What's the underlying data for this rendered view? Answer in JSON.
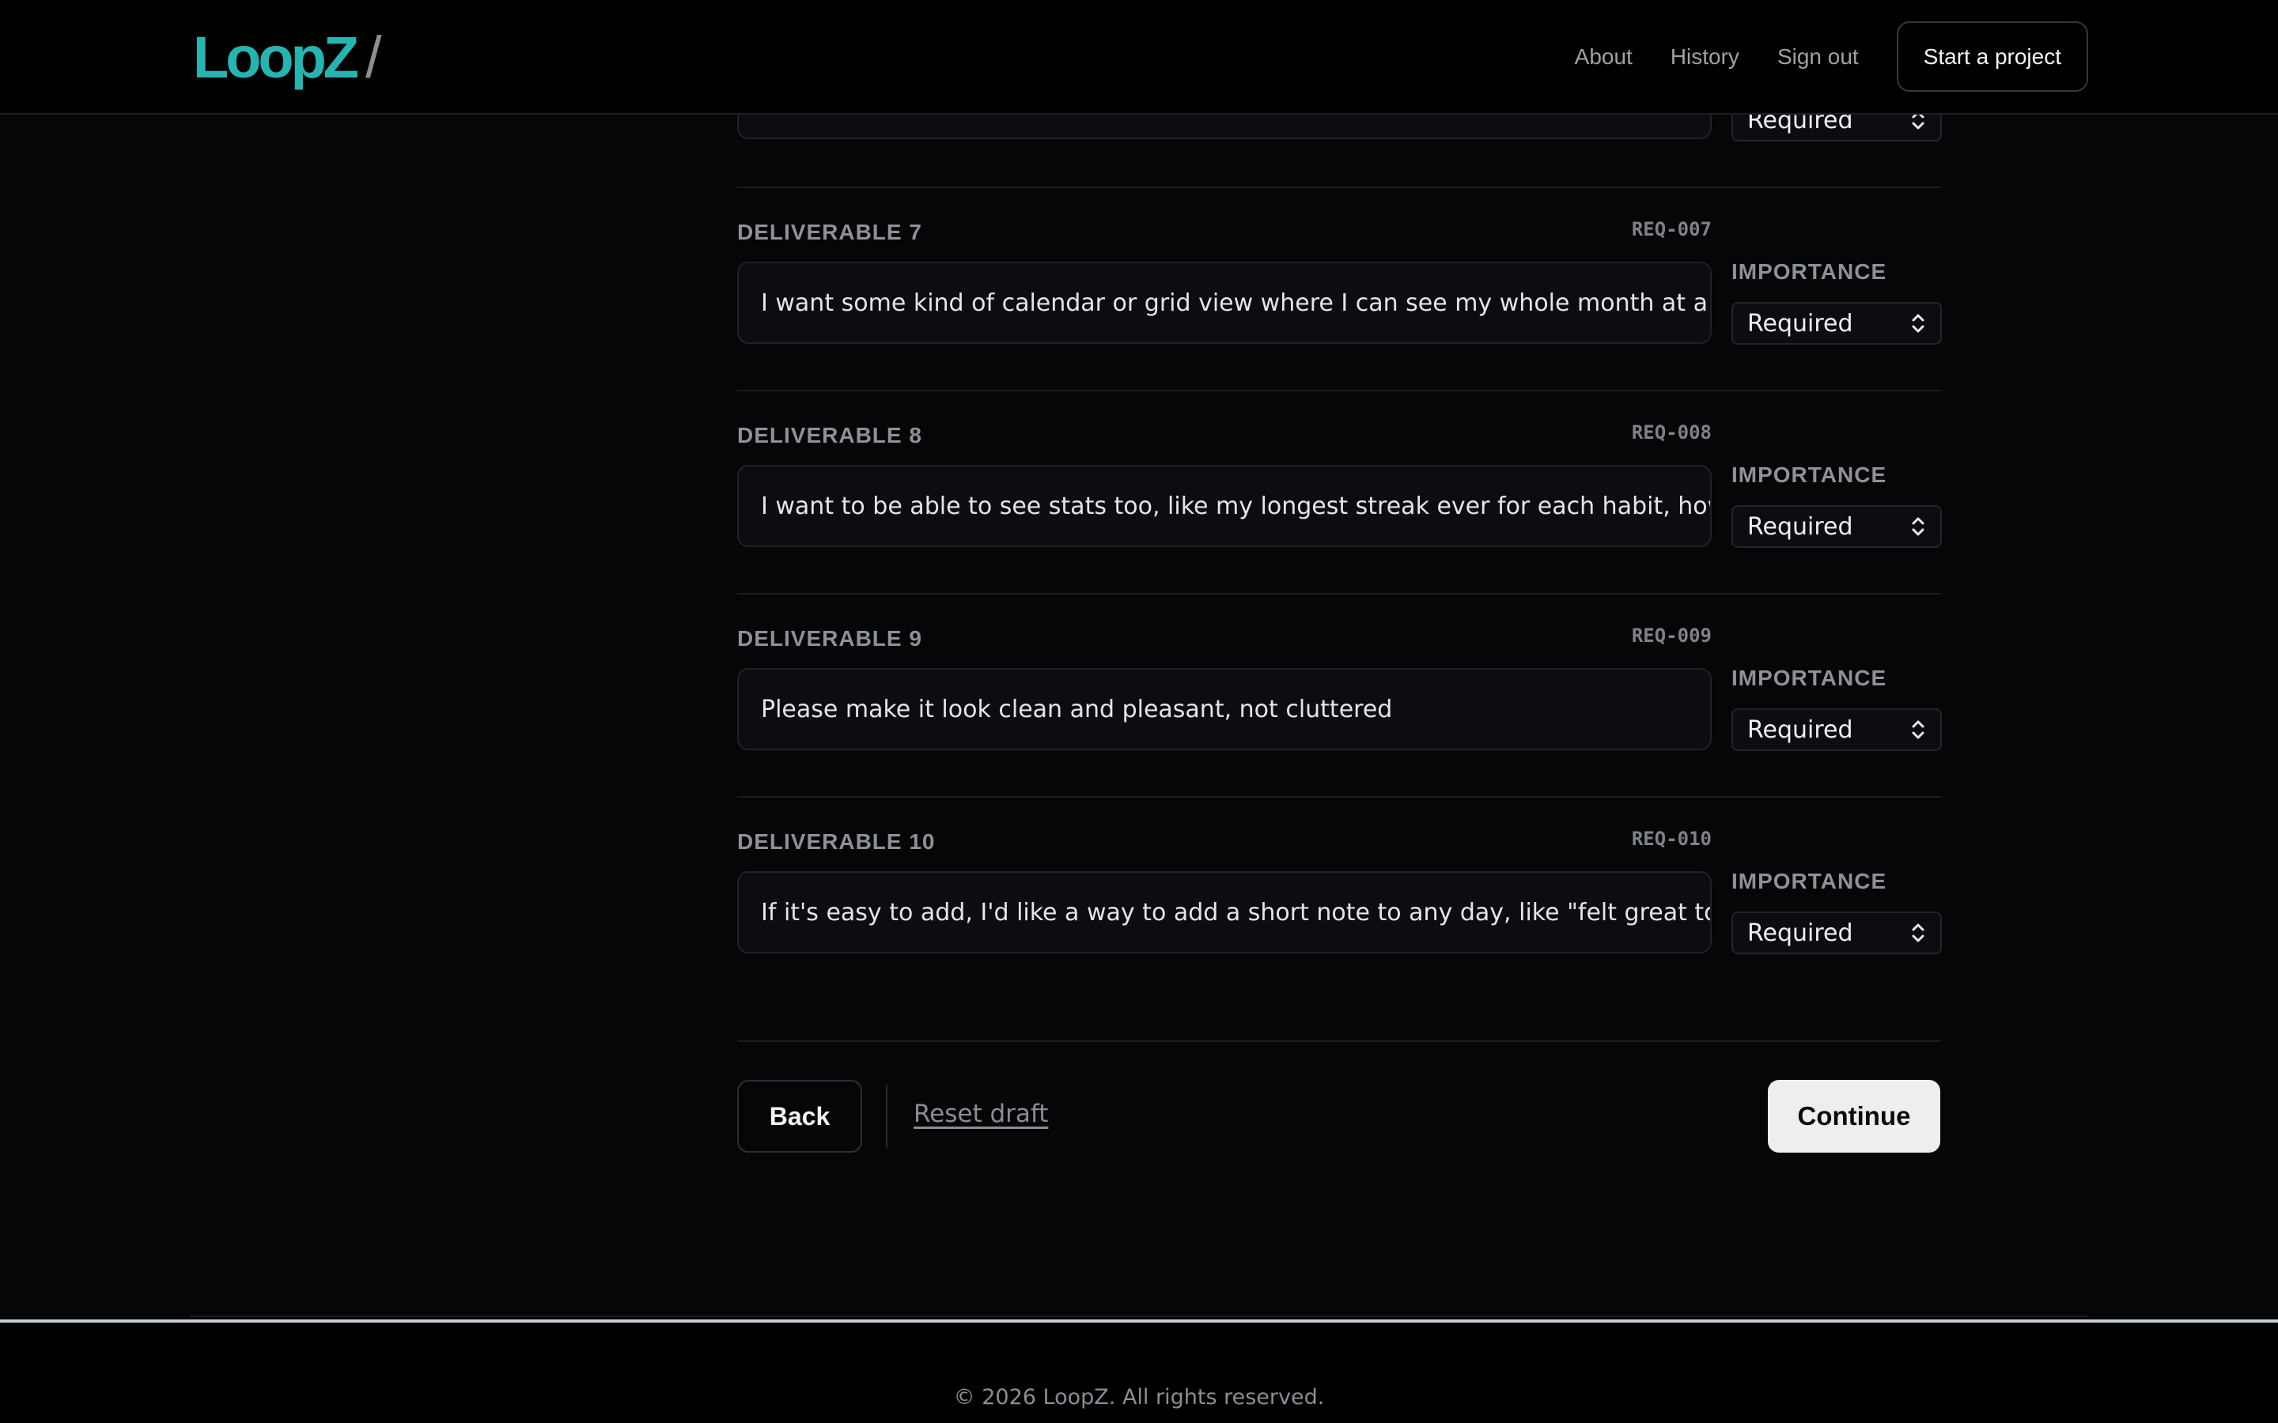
{
  "header": {
    "logo": "LoopZ",
    "logo_slash": "/",
    "nav": [
      "About",
      "History",
      "Sign out"
    ],
    "cta": "Start a project"
  },
  "partial_row": {
    "select_value": "Required"
  },
  "deliverables": [
    {
      "label": "DELIVERABLE 7",
      "code": "REQ-007",
      "text": "I want some kind of calendar or grid view where I can see my whole month at a g",
      "importance_label": "IMPORTANCE",
      "importance": "Required"
    },
    {
      "label": "DELIVERABLE 8",
      "code": "REQ-008",
      "text": "I want to be able to see stats too, like my longest streak ever for each habit, how",
      "importance_label": "IMPORTANCE",
      "importance": "Required"
    },
    {
      "label": "DELIVERABLE 9",
      "code": "REQ-009",
      "text": "Please make it look clean and pleasant, not cluttered",
      "importance_label": "IMPORTANCE",
      "importance": "Required"
    },
    {
      "label": "DELIVERABLE 10",
      "code": "REQ-010",
      "text": "If it's easy to add, I'd like a way to add a short note to any day, like \"felt great toda",
      "importance_label": "IMPORTANCE",
      "importance": "Required"
    }
  ],
  "actions": {
    "back": "Back",
    "reset": "Reset draft",
    "continue": "Continue"
  },
  "footer": {
    "copyright": "© 2026 LoopZ. All rights reserved."
  },
  "colors": {
    "brand": "#25b5b0",
    "background": "#050608",
    "continue_bg": "#eceef0"
  },
  "icons": {
    "select_chevron": "chevron-up-down-icon"
  }
}
